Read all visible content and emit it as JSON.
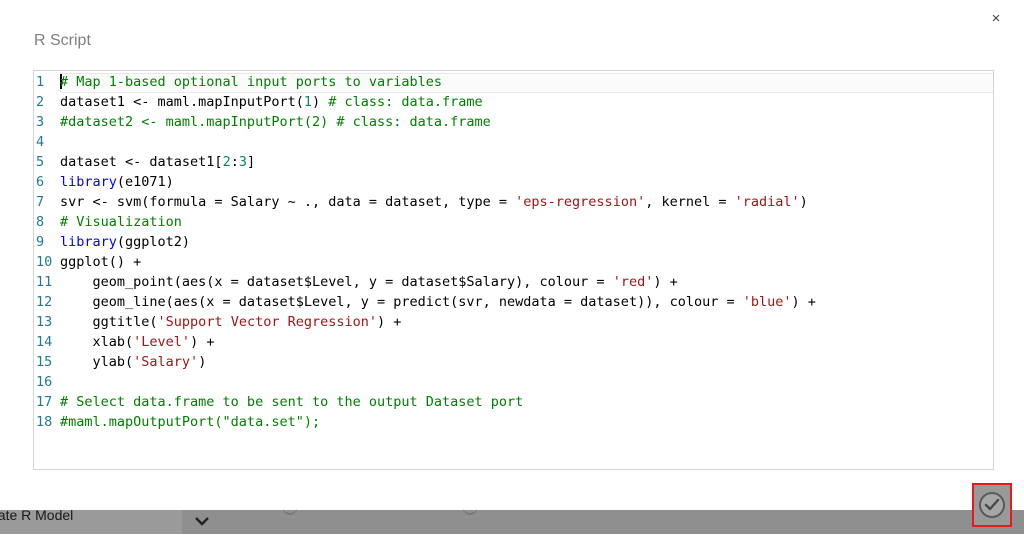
{
  "dialog": {
    "title": "R Script",
    "close_glyph": "×"
  },
  "editor": {
    "lines": [
      {
        "n": "1",
        "segments": [
          {
            "t": "# Map 1-based optional input ports to variables",
            "c": "com"
          }
        ]
      },
      {
        "n": "2",
        "segments": [
          {
            "t": "dataset1 <- maml.mapInputPort(",
            "c": "plain"
          },
          {
            "t": "1",
            "c": "num"
          },
          {
            "t": ") ",
            "c": "plain"
          },
          {
            "t": "# class: data.frame",
            "c": "com"
          }
        ]
      },
      {
        "n": "3",
        "segments": [
          {
            "t": "#dataset2 <- maml.mapInputPort(2) # class: data.frame",
            "c": "com"
          }
        ]
      },
      {
        "n": "4",
        "segments": [
          {
            "t": "",
            "c": "plain"
          }
        ]
      },
      {
        "n": "5",
        "segments": [
          {
            "t": "dataset <- dataset1[",
            "c": "plain"
          },
          {
            "t": "2",
            "c": "num"
          },
          {
            "t": ":",
            "c": "plain"
          },
          {
            "t": "3",
            "c": "num"
          },
          {
            "t": "]",
            "c": "plain"
          }
        ]
      },
      {
        "n": "6",
        "segments": [
          {
            "t": "library",
            "c": "kw"
          },
          {
            "t": "(e1071)",
            "c": "plain"
          }
        ]
      },
      {
        "n": "7",
        "segments": [
          {
            "t": "svr <- svm(formula = Salary ~ ., data = dataset, type = ",
            "c": "plain"
          },
          {
            "t": "'eps-regression'",
            "c": "str"
          },
          {
            "t": ", kernel = ",
            "c": "plain"
          },
          {
            "t": "'radial'",
            "c": "str"
          },
          {
            "t": ")",
            "c": "plain"
          }
        ]
      },
      {
        "n": "8",
        "segments": [
          {
            "t": "# Visualization",
            "c": "com"
          }
        ]
      },
      {
        "n": "9",
        "segments": [
          {
            "t": "library",
            "c": "kw"
          },
          {
            "t": "(ggplot2)",
            "c": "plain"
          }
        ]
      },
      {
        "n": "10",
        "segments": [
          {
            "t": "ggplot() +",
            "c": "plain"
          }
        ]
      },
      {
        "n": "11",
        "segments": [
          {
            "t": "    geom_point(aes(x = dataset$Level, y = dataset$Salary), colour = ",
            "c": "plain"
          },
          {
            "t": "'red'",
            "c": "str"
          },
          {
            "t": ") +",
            "c": "plain"
          }
        ]
      },
      {
        "n": "12",
        "segments": [
          {
            "t": "    geom_line(aes(x = dataset$Level, y = predict(svr, newdata = dataset)), colour = ",
            "c": "plain"
          },
          {
            "t": "'blue'",
            "c": "str"
          },
          {
            "t": ") +",
            "c": "plain"
          }
        ]
      },
      {
        "n": "13",
        "segments": [
          {
            "t": "    ggtitle(",
            "c": "plain"
          },
          {
            "t": "'Support Vector Regression'",
            "c": "str"
          },
          {
            "t": ") +",
            "c": "plain"
          }
        ]
      },
      {
        "n": "14",
        "segments": [
          {
            "t": "    xlab(",
            "c": "plain"
          },
          {
            "t": "'Level'",
            "c": "str"
          },
          {
            "t": ") +",
            "c": "plain"
          }
        ]
      },
      {
        "n": "15",
        "segments": [
          {
            "t": "    ylab(",
            "c": "plain"
          },
          {
            "t": "'Salary'",
            "c": "str"
          },
          {
            "t": ")",
            "c": "plain"
          }
        ]
      },
      {
        "n": "16",
        "segments": [
          {
            "t": "",
            "c": "plain"
          }
        ]
      },
      {
        "n": "17",
        "segments": [
          {
            "t": "# Select data.frame to be sent to the output Dataset port",
            "c": "com"
          }
        ]
      },
      {
        "n": "18",
        "segments": [
          {
            "t": "#maml.mapOutputPort(\"data.set\");",
            "c": "com"
          }
        ]
      }
    ]
  },
  "background": {
    "module_label": "eate R Model"
  },
  "icons": {
    "close": "close-icon",
    "ok": "checkmark-icon",
    "chevron": "chevron-down-icon"
  },
  "colors": {
    "comment": "#008000",
    "keyword": "#0000ff",
    "string": "#a31515",
    "number": "#098658",
    "line_number": "#237893",
    "highlight": "#e31b1b"
  }
}
